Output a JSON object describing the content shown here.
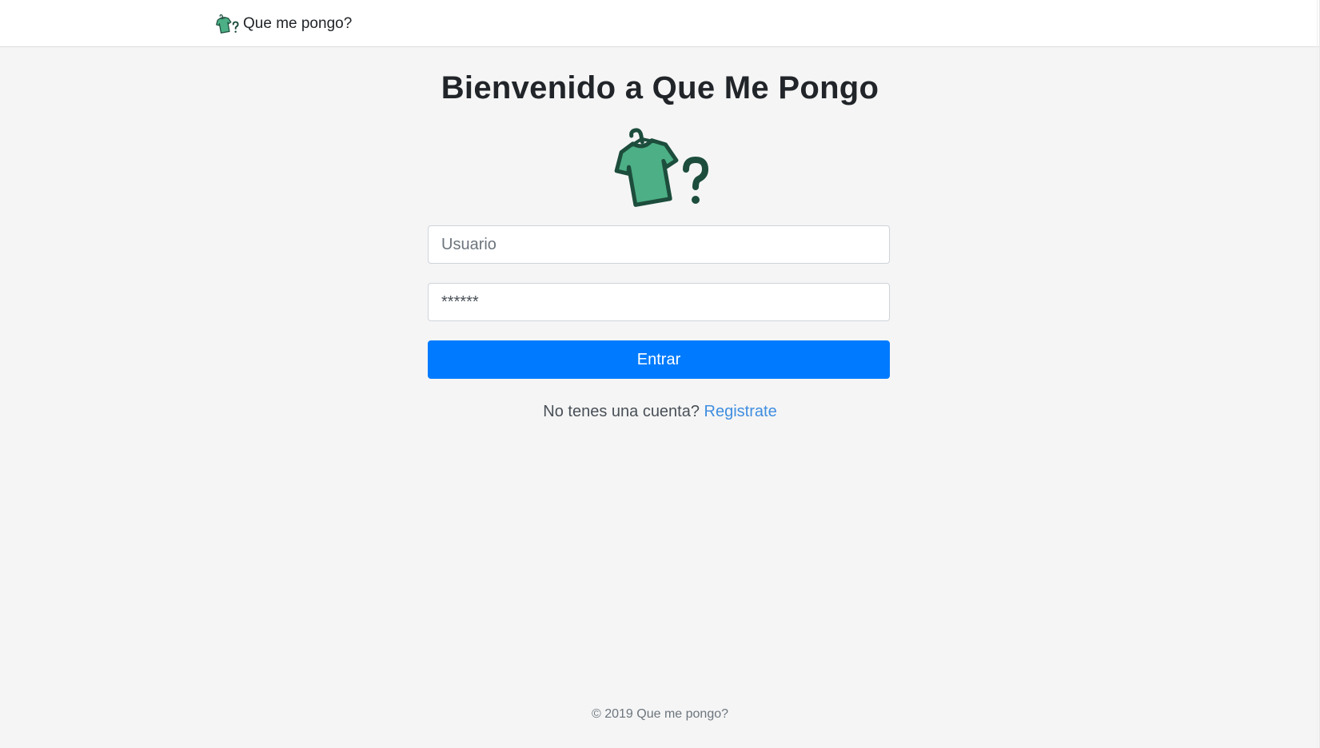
{
  "navbar": {
    "brand_text": "Que me pongo?",
    "logo_icon": "shirt-hanger-question-icon"
  },
  "main": {
    "title": "Bienvenido a Que Me Pongo",
    "hero_icon": "shirt-hanger-question-icon",
    "username_placeholder": "Usuario",
    "password_value": "******",
    "submit_label": "Entrar",
    "register_prompt": "No tenes una cuenta?",
    "register_link": "Registrate"
  },
  "footer": {
    "copyright": "© 2019 Que me pongo?"
  },
  "colors": {
    "primary": "#007bff",
    "link": "#3f8ee0",
    "shirt_fill": "#4caf85",
    "shirt_outline": "#1d4d3c",
    "background": "#f5f5f5"
  }
}
